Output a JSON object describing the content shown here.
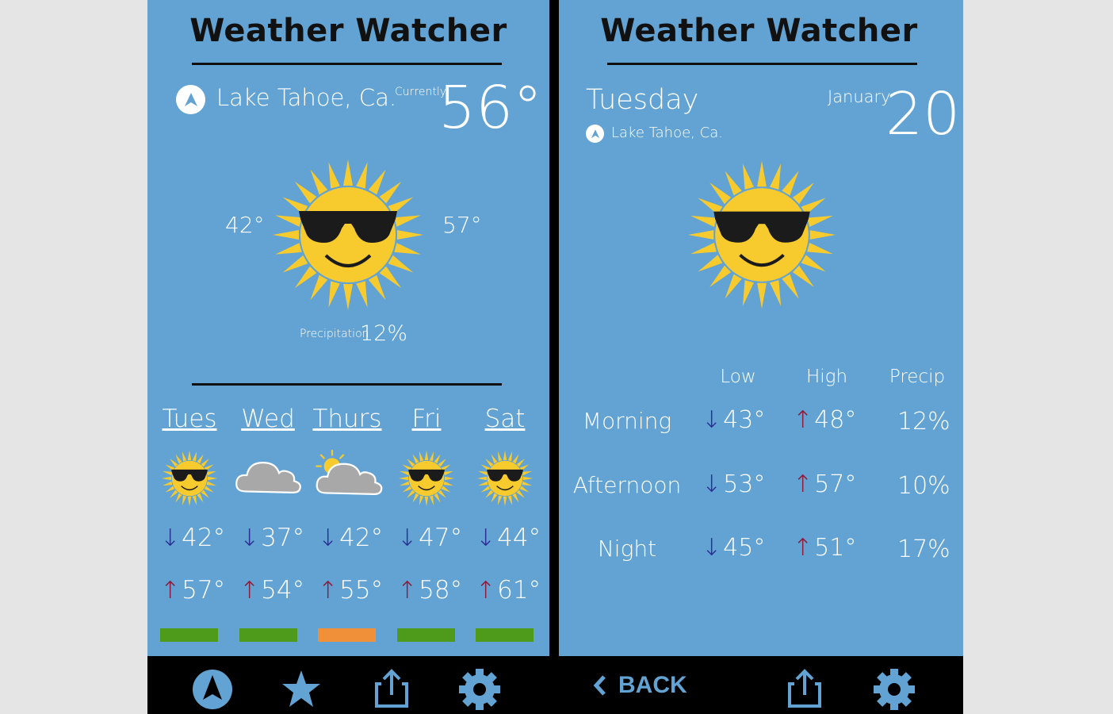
{
  "app_title": "Weather Watcher",
  "left_screen": {
    "location": "Lake Tahoe, Ca.",
    "current_label": "Currently",
    "current_temp": "56°",
    "low": "42°",
    "high": "57°",
    "precip_label": "Precipitation",
    "precip_value": "12%",
    "forecast": [
      {
        "day": "Tues",
        "icon": "sun-sunglasses-icon",
        "low": "42°",
        "high": "57°",
        "bar_color": "#4e9a1a"
      },
      {
        "day": "Wed",
        "icon": "cloud-icon",
        "low": "37°",
        "high": "54°",
        "bar_color": "#4e9a1a"
      },
      {
        "day": "Thurs",
        "icon": "partly-cloudy-icon",
        "low": "42°",
        "high": "55°",
        "bar_color": "#f0913a"
      },
      {
        "day": "Fri",
        "icon": "sun-sunglasses-icon",
        "low": "47°",
        "high": "58°",
        "bar_color": "#4e9a1a"
      },
      {
        "day": "Sat",
        "icon": "sun-sunglasses-icon",
        "low": "44°",
        "high": "61°",
        "bar_color": "#4e9a1a"
      }
    ],
    "nav": [
      "navigation-icon",
      "star-icon",
      "share-icon",
      "gear-icon"
    ]
  },
  "right_screen": {
    "day": "Tuesday",
    "location": "Lake Tahoe, Ca.",
    "month": "January",
    "date": "20",
    "columns": [
      "Low",
      "High",
      "Precip"
    ],
    "rows": [
      {
        "label": "Morning",
        "low": "43°",
        "high": "48°",
        "precip": "12%"
      },
      {
        "label": "Afternoon",
        "low": "53°",
        "high": "57°",
        "precip": "10%"
      },
      {
        "label": "Night",
        "low": "45°",
        "high": "51°",
        "precip": "17%"
      }
    ],
    "back_label": "BACK",
    "nav": [
      "back-icon",
      "share-icon",
      "gear-icon"
    ]
  },
  "colors": {
    "panel_bg": "#62a3d3",
    "accent": "#62a3d3",
    "arrow_down": "#2b2f94",
    "arrow_up": "#8e1b3a",
    "sun": "#f7cb2d"
  }
}
